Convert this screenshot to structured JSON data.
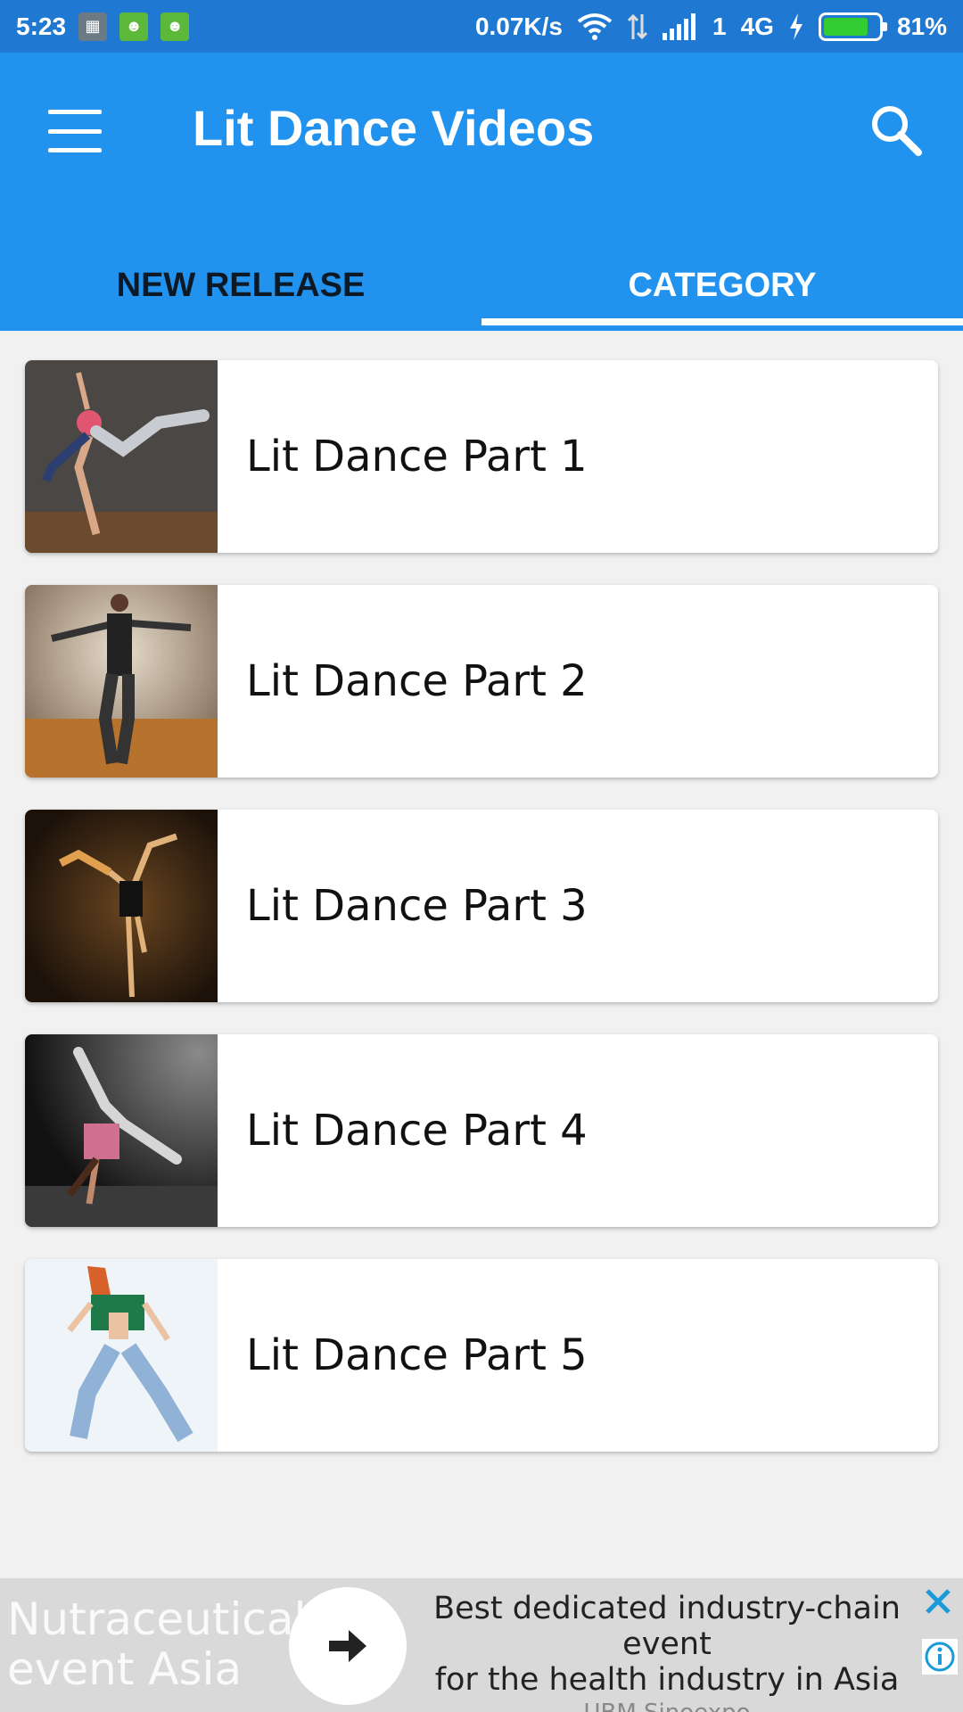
{
  "status_bar": {
    "time": "5:23",
    "network_speed": "0.07K/s",
    "sim": "1",
    "network_type": "4G",
    "battery_percent": "81%",
    "battery_level": 0.81,
    "icons": [
      "bbm-icon",
      "android-icon",
      "android-icon",
      "wifi-icon",
      "data-arrows-icon",
      "signal-icon",
      "charging-icon",
      "battery-icon"
    ]
  },
  "app_bar": {
    "title": "Lit Dance Videos",
    "menu_icon": "hamburger-menu-icon",
    "search_icon": "search-icon",
    "background": "#2193ee"
  },
  "tabs": [
    {
      "label": "NEW RELEASE",
      "selected": false
    },
    {
      "label": "CATEGORY",
      "selected": true
    }
  ],
  "videos": [
    {
      "title": "Lit Dance Part 1"
    },
    {
      "title": "Lit Dance Part 2"
    },
    {
      "title": "Lit Dance Part 3"
    },
    {
      "title": "Lit Dance Part 4"
    },
    {
      "title": "Lit Dance Part 5"
    }
  ],
  "ad": {
    "brand_line1": "Nutraceutical",
    "brand_line2": "event Asia",
    "headline_line1": "Best dedicated industry-chain event",
    "headline_line2": "for the health industry in Asia",
    "sponsor": "UBM Sinoexpo",
    "cta_icon": "arrow-right-icon",
    "close_icon": "close-icon",
    "info_icon": "info-icon"
  }
}
